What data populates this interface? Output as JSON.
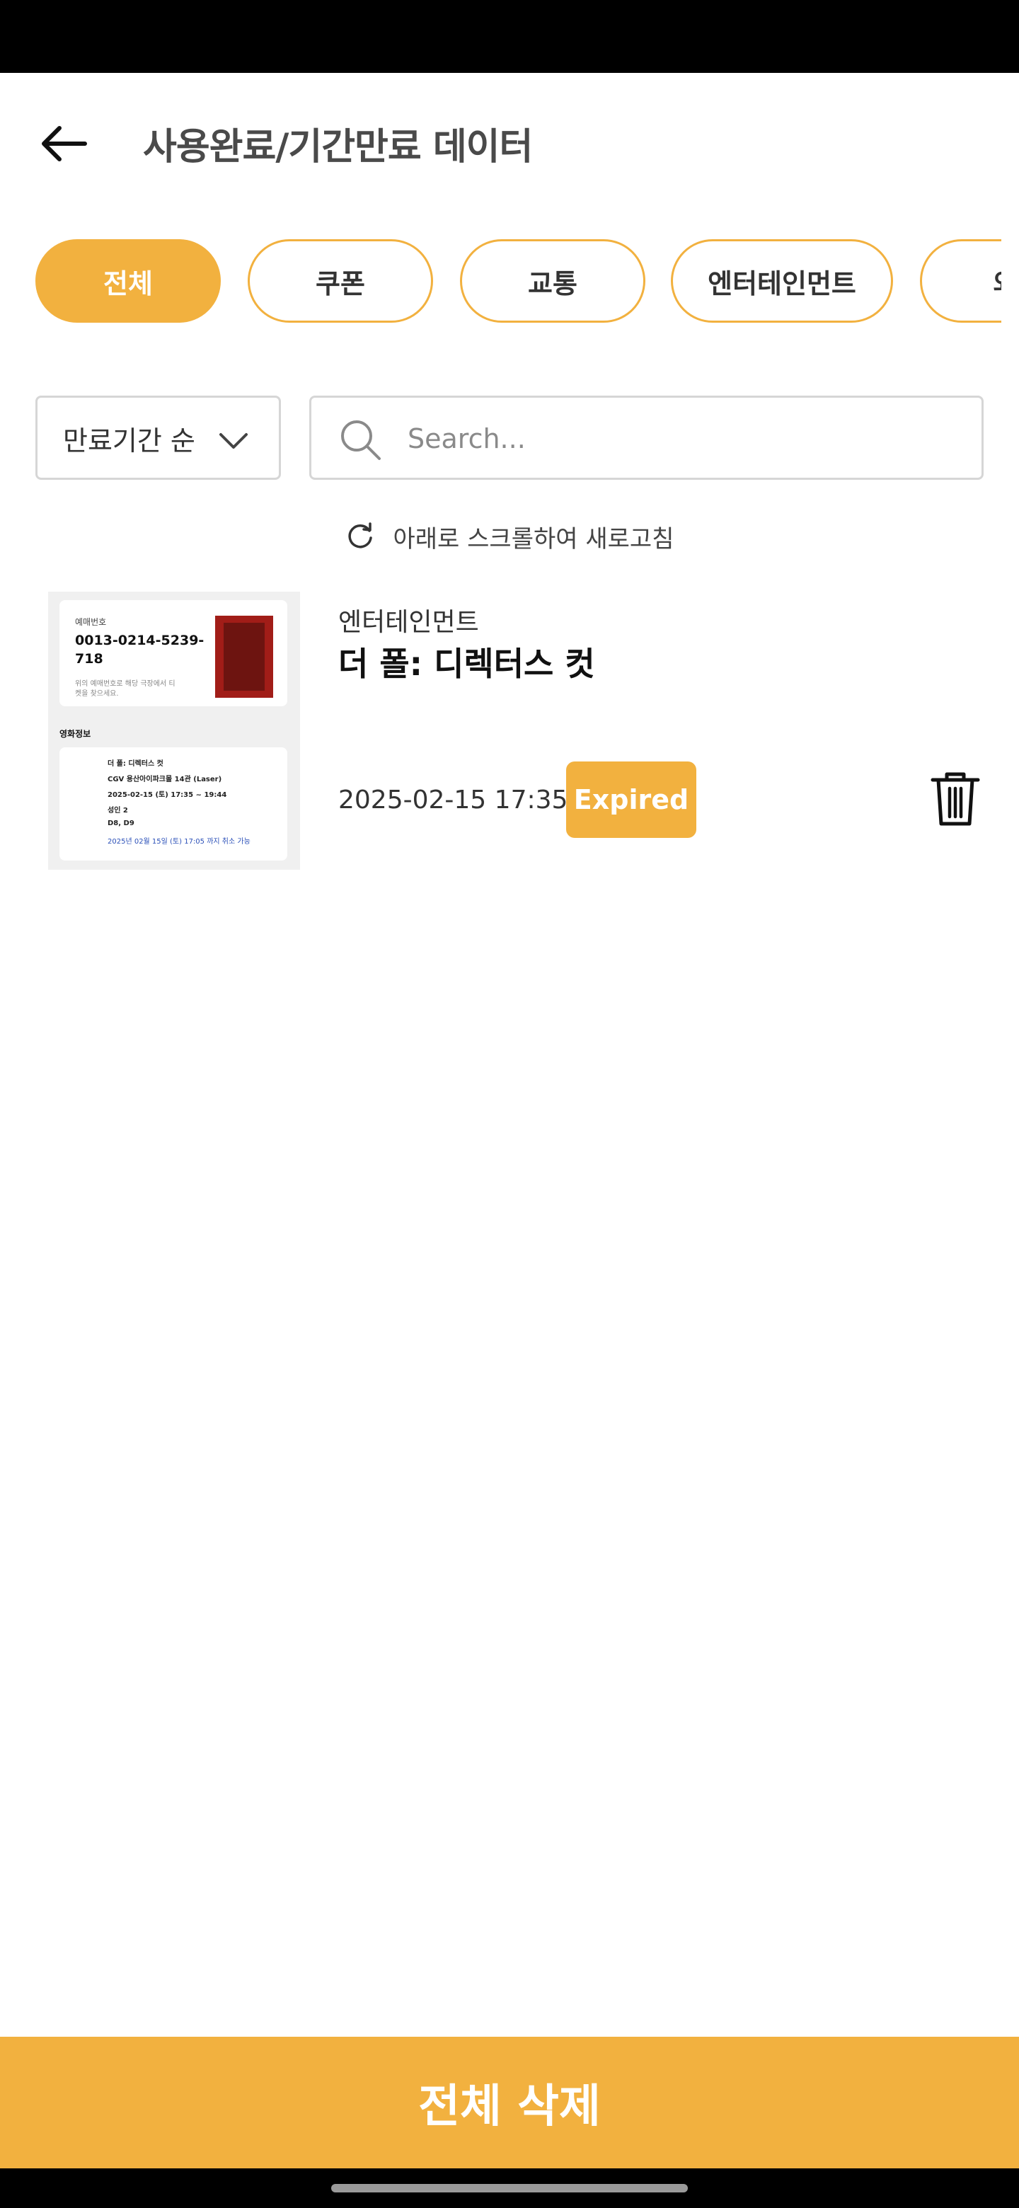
{
  "header": {
    "title": "사용완료/기간만료 데이터"
  },
  "tabs": [
    {
      "label": "전체",
      "active": true
    },
    {
      "label": "쿠폰",
      "active": false
    },
    {
      "label": "교통",
      "active": false
    },
    {
      "label": "엔터테인먼트",
      "active": false
    },
    {
      "label": "외",
      "active": false
    }
  ],
  "filters": {
    "sort_label": "만료기간 순",
    "search_placeholder": "Search..."
  },
  "refresh_hint": "아래로 스크롤하여 새로고침",
  "items": [
    {
      "category": "엔터테인먼트",
      "title": "더 폴: 디렉터스 컷",
      "datetime": "2025-02-15 17:35",
      "status": "Expired",
      "thumbnail": {
        "booking_label": "예매번호",
        "booking_number": "0013-0214-5239-718",
        "notice": "위의 예매번호로 해당 극장에서 티켓을 찾으세요.",
        "section_title": "영화정보",
        "details": [
          "더 폴: 디렉터스 컷",
          "CGV 용산아이파크몰 14관 (Laser)",
          "2025-02-15 (토) 17:35 ~ 19:44",
          "성인 2",
          "D8, D9",
          "2025년 02월 15일 (토) 17:05 까지 취소 가능"
        ]
      }
    }
  ],
  "footer": {
    "delete_all_label": "전체 삭제"
  },
  "colors": {
    "accent": "#F2B13F",
    "border": "#d6d6d6"
  }
}
